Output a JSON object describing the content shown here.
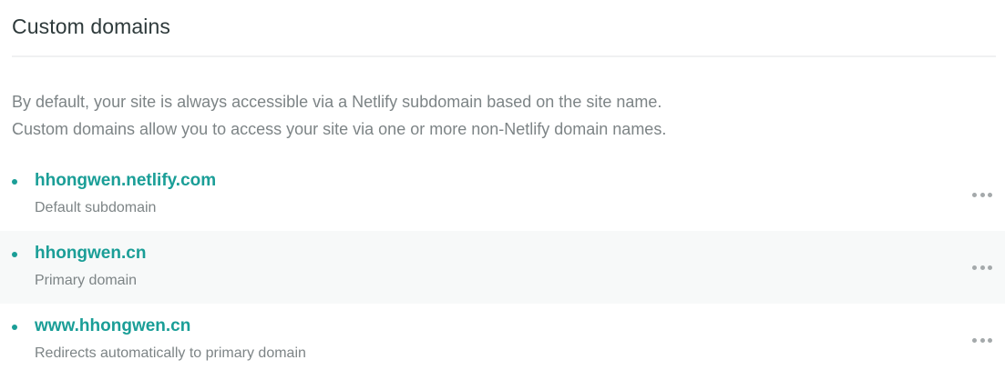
{
  "section": {
    "title": "Custom domains",
    "description_lines": [
      "By default, your site is always accessible via a Netlify subdomain based on the site name.",
      "Custom domains allow you to access your site via one or more non-Netlify domain names."
    ]
  },
  "domains": [
    {
      "name": "hhongwen.netlify.com",
      "label": "Default subdomain"
    },
    {
      "name": "hhongwen.cn",
      "label": "Primary domain"
    },
    {
      "name": "www.hhongwen.cn",
      "label": "Redirects automatically to primary domain"
    }
  ],
  "icons": {
    "bullet": "bullet-dot-icon",
    "menu": "more-options-icon"
  },
  "colors": {
    "accent": "#1a9e97",
    "text_muted": "#7d8486",
    "title": "#2e3a3b",
    "alt_row": "#f7f9f9"
  }
}
